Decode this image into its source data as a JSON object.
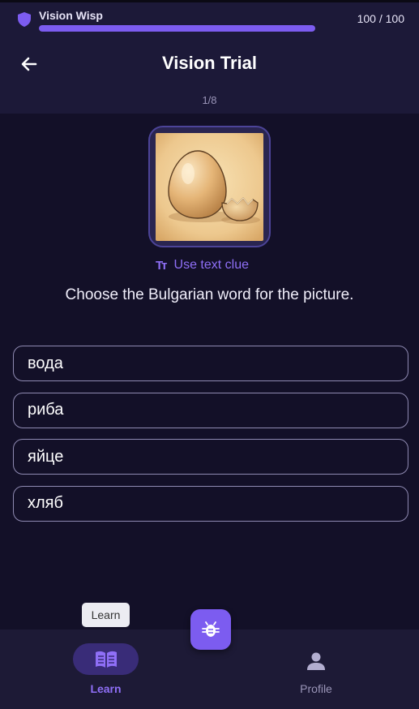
{
  "status": {
    "wisp_name": "Vision Wisp",
    "hp_text": "100 / 100",
    "hp_fraction": 1.0,
    "shield_icon": "shield-icon",
    "accent": "#7c5cf0"
  },
  "header": {
    "title": "Vision Trial",
    "progress": "1/8",
    "back_icon": "arrow-left-icon"
  },
  "question": {
    "image": "egg-illustration",
    "clue_icon_text": "Tт",
    "clue_label": "Use text clue",
    "prompt": "Choose the Bulgarian word for the picture."
  },
  "options": [
    "вода",
    "риба",
    "яйце",
    "хляб"
  ],
  "tooltip": "Learn",
  "fab": {
    "icon": "bug-icon"
  },
  "nav": {
    "learn_label": "Learn",
    "learn_icon": "book-icon",
    "profile_label": "Profile",
    "profile_icon": "person-icon"
  }
}
